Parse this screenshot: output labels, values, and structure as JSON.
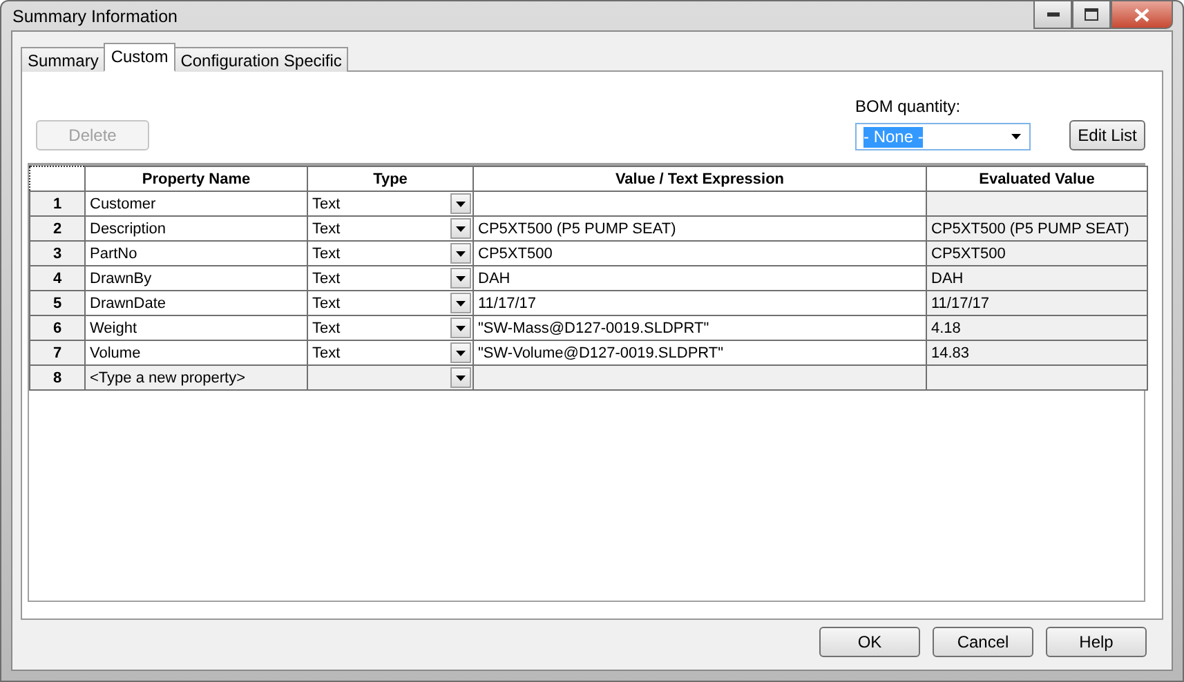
{
  "window": {
    "title": "Summary Information"
  },
  "tabs": [
    {
      "label": "Summary",
      "selected": false
    },
    {
      "label": "Custom",
      "selected": true
    },
    {
      "label": "Configuration Specific",
      "selected": false
    }
  ],
  "delete_button": {
    "label": "Delete",
    "disabled": true
  },
  "bom_quantity": {
    "label": "BOM quantity:",
    "value": "- None -",
    "text_selected": true
  },
  "edit_list_button": {
    "label": "Edit List"
  },
  "table": {
    "columns": [
      "Property Name",
      "Type",
      "Value / Text Expression",
      "Evaluated Value"
    ],
    "rows": [
      {
        "kind": "property",
        "number": "1",
        "name": "Customer",
        "type": "Text"
      },
      {
        "kind": "property",
        "number": "2",
        "name": "Description",
        "type": "Text",
        "value": "CP5XT500 (P5 PUMP SEAT)",
        "evaluated": "CP5XT500 (P5 PUMP SEAT)"
      },
      {
        "kind": "property",
        "number": "3",
        "name": "PartNo",
        "type": "Text",
        "value": "CP5XT500",
        "evaluated": "CP5XT500"
      },
      {
        "kind": "property",
        "number": "4",
        "name": "DrawnBy",
        "type": "Text",
        "value": "DAH",
        "evaluated": "DAH"
      },
      {
        "kind": "property",
        "number": "5",
        "name": "DrawnDate",
        "type": "Text",
        "value": "11/17/17",
        "evaluated": "11/17/17"
      },
      {
        "kind": "property",
        "number": "6",
        "name": "Weight",
        "type": "Text",
        "value": "\"SW-Mass@D127-0019.SLDPRT\"",
        "evaluated": "4.18"
      },
      {
        "kind": "property",
        "number": "7",
        "name": "Volume",
        "type": "Text",
        "value": "\"SW-Volume@D127-0019.SLDPRT\"",
        "evaluated": "14.83"
      },
      {
        "kind": "new",
        "number": "8",
        "name": "<Type a new property>"
      }
    ]
  },
  "buttons": [
    "OK",
    "Cancel",
    "Help"
  ]
}
